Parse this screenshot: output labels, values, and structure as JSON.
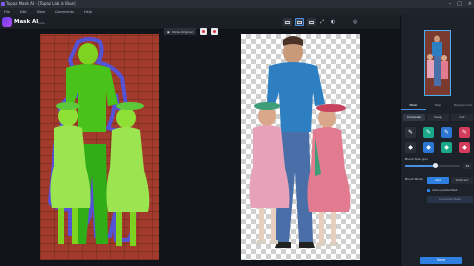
{
  "window": {
    "title": "Topaz Mask AI - [Topaz Lab is Blue]"
  },
  "menu": [
    "File",
    "Edit",
    "View",
    "Comments",
    "Help"
  ],
  "toolbar": {
    "app_title": "Mask AI",
    "badge": "beta"
  },
  "canvas_tools": {
    "show_original_label": "Show Original"
  },
  "panel": {
    "tabs": [
      "Mask",
      "Map",
      "Background"
    ],
    "active_tab": 0,
    "subtabs": [
      "Compute",
      "Keep",
      "Cut"
    ],
    "active_subtab": 0,
    "brush_size_label": "Brush Size (px)",
    "brush_size_value": "25",
    "brush_fraction": 0.55,
    "brush_mode_label": "Brush Mode",
    "modes": [
      "Add",
      "Subtract"
    ],
    "active_mode": 0,
    "checkbox_label": "Auto-update Mask",
    "apply_label": "Compute Mask",
    "save_label": "Save"
  },
  "colors": {
    "accent": "#2f7fe0",
    "keep": "#19a88a",
    "cut": "#d43c5b",
    "compute": "#2b76d2"
  }
}
